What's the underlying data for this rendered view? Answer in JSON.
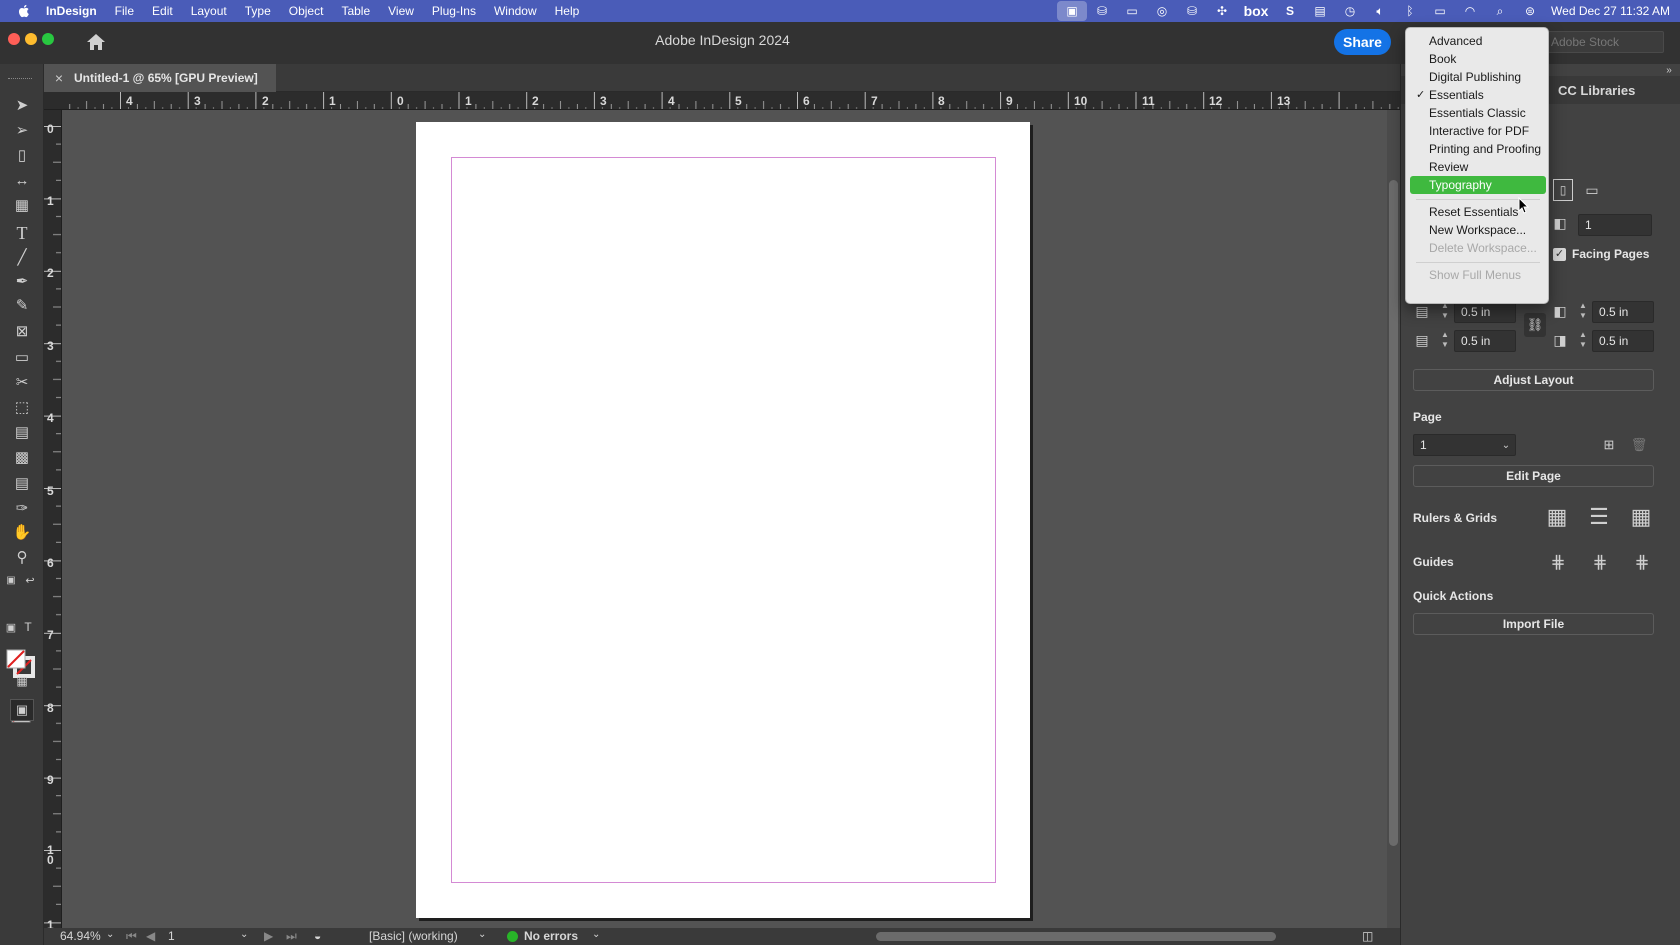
{
  "menubar": {
    "app_name": "InDesign",
    "items": [
      "File",
      "Edit",
      "Layout",
      "Type",
      "Object",
      "Table",
      "View",
      "Plug-Ins",
      "Window",
      "Help"
    ],
    "box_label": "box",
    "clock": "Wed Dec 27  11:32 AM"
  },
  "window": {
    "title": "Adobe InDesign 2024",
    "share_label": "Share",
    "stock_placeholder": "Adobe Stock"
  },
  "document_tab": {
    "close": "×",
    "title": "Untitled-1 @ 65% [GPU Preview]"
  },
  "rulers": {
    "horizontal": [
      "4",
      "3",
      "2",
      "1",
      "0",
      "1",
      "2",
      "3",
      "4",
      "5",
      "6",
      "7",
      "8",
      "9",
      "10",
      "11",
      "12",
      "13"
    ],
    "vertical": [
      "0",
      "1",
      "2",
      "3",
      "4",
      "5",
      "6",
      "7",
      "8",
      "9",
      "1\n0",
      "1"
    ]
  },
  "statusbar": {
    "zoom": "64.94%",
    "page": "1",
    "preflight_profile": "[Basic] (working)",
    "errors": "No errors"
  },
  "right_panel": {
    "cc_libraries": "CC Libraries",
    "pages_value": "1",
    "facing_pages_label": "Facing Pages",
    "margin_top": "0.5 in",
    "margin_bottom": "0.5 in",
    "margin_left": "0.5 in",
    "margin_right": "0.5 in",
    "adjust_layout": "Adjust Layout",
    "page_section": "Page",
    "page_select_value": "1",
    "edit_page": "Edit Page",
    "rulers_grids": "Rulers & Grids",
    "guides": "Guides",
    "quick_actions": "Quick Actions",
    "import_file": "Import File"
  },
  "workspace_menu": {
    "items": [
      {
        "label": "Advanced"
      },
      {
        "label": "Book"
      },
      {
        "label": "Digital Publishing"
      },
      {
        "label": "Essentials",
        "checked": true
      },
      {
        "label": "Essentials Classic"
      },
      {
        "label": "Interactive for PDF"
      },
      {
        "label": "Printing and Proofing"
      },
      {
        "label": "Review"
      },
      {
        "label": "Typography",
        "selected": true
      },
      {
        "label": "Reset Essentials"
      },
      {
        "label": "New Workspace..."
      },
      {
        "label": "Delete Workspace...",
        "disabled": true
      },
      {
        "label": "Show Full Menus",
        "disabled": true
      }
    ],
    "checkmark": "✓"
  },
  "colors": {
    "menubar": "#4a5cb8",
    "share": "#1473e6",
    "menu_highlight": "#3fb93f",
    "margin_guide": "#d48ad4",
    "no_errors_dot": "#28b428"
  }
}
